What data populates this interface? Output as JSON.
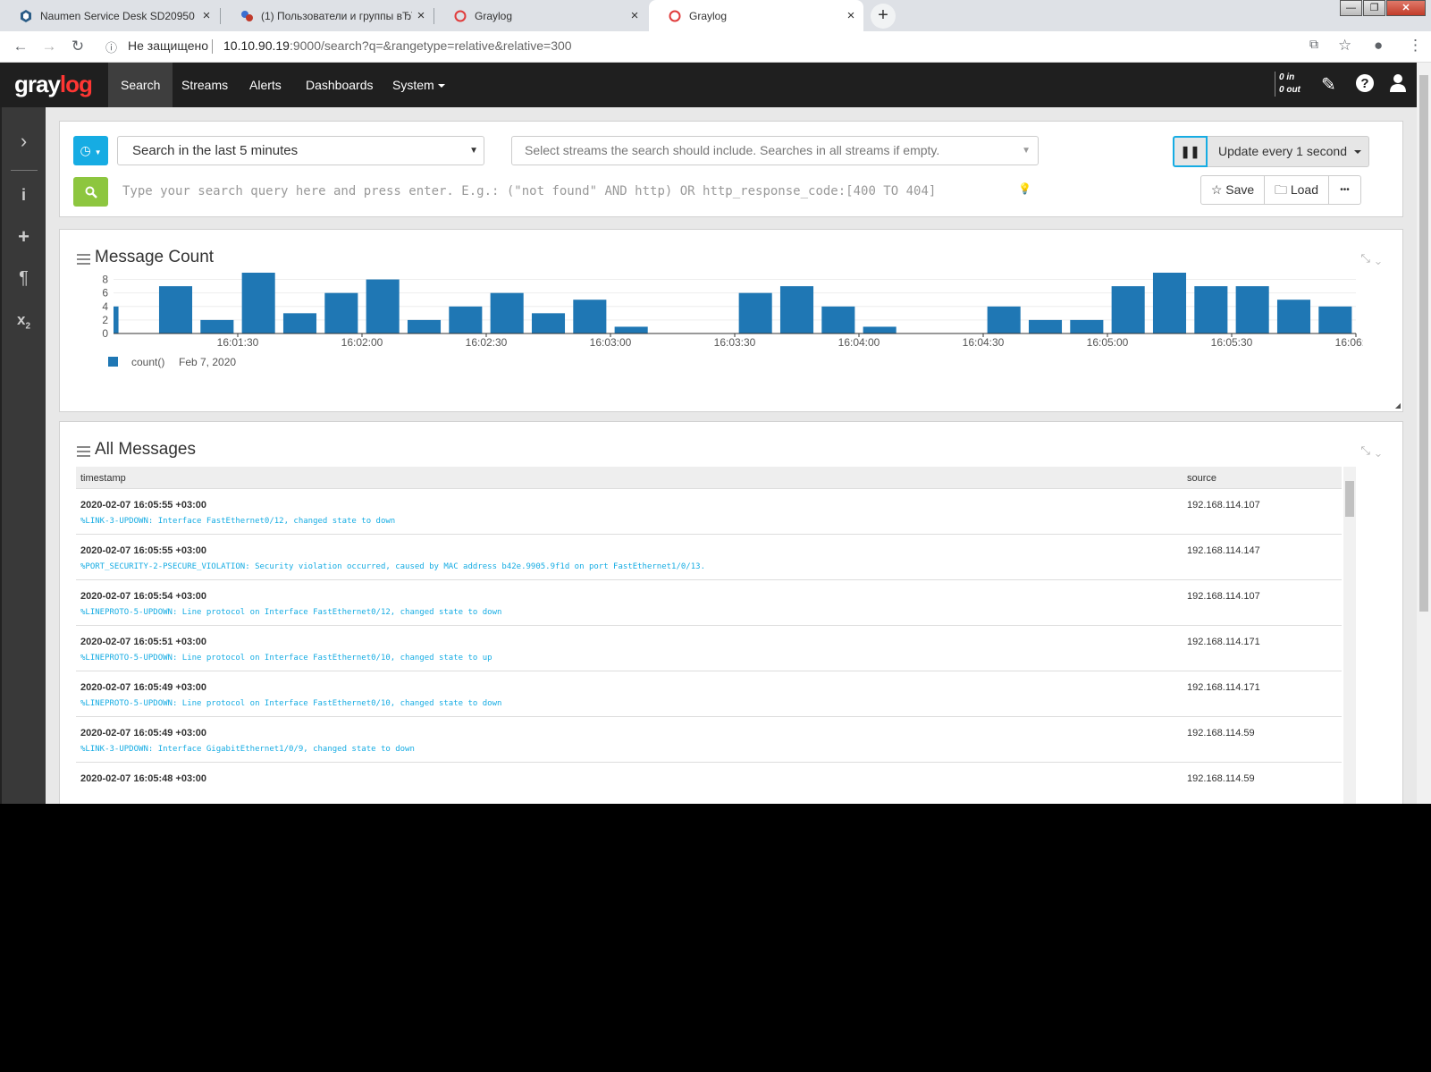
{
  "browser": {
    "tabs": [
      {
        "title": "Naumen Service Desk SD20950",
        "close": "×"
      },
      {
        "title": "(1) Пользователи и группы вЂ˘",
        "close": "×"
      },
      {
        "title": "Graylog",
        "close": "×"
      },
      {
        "title": "Graylog",
        "close": "×"
      }
    ],
    "new_tab": "+",
    "window_controls": {
      "minimize": "—",
      "maximize": "❐",
      "close": "✕"
    },
    "security_label": "Не защищено",
    "url_host": "10.10.90.19",
    "url_rest": ":9000/search?q=&rangetype=relative&relative=300"
  },
  "nav": {
    "logo_gray": "gray",
    "logo_log": "log",
    "items": [
      "Search",
      "Streams",
      "Alerts",
      "Dashboards",
      "System"
    ],
    "throughput_in": "0 in",
    "throughput_out": "0 out"
  },
  "search": {
    "range_value": "Search in the last 5 minutes",
    "streams_placeholder": "Select streams the search should include. Searches in all streams if empty.",
    "update_label": "Update every 1 second",
    "query_placeholder": "Type your search query here and press enter. E.g.: (\"not found\" AND http) OR http_response_code:[400 TO 404]",
    "save_label": "Save",
    "load_label": "Load",
    "more_label": "•••"
  },
  "message_count": {
    "title": "Message Count"
  },
  "chart_data": {
    "type": "bar",
    "title": "Message Count",
    "y_ticks": [
      "0",
      "2",
      "4",
      "6",
      "8"
    ],
    "ylim": [
      0,
      9
    ],
    "x_tick_labels": [
      "16:01:30",
      "16:02:00",
      "16:02:30",
      "16:03:00",
      "16:03:30",
      "16:04:00",
      "16:04:30",
      "16:05:00",
      "16:05:30",
      "16:06:00"
    ],
    "x_start": "16:01:00",
    "x_end": "16:06:00",
    "bin_seconds": 10,
    "series": [
      {
        "name": "count()",
        "color": "#1f77b4",
        "bins": [
          {
            "t": "16:01:00",
            "v": 4
          },
          {
            "t": "16:01:10",
            "v": 7
          },
          {
            "t": "16:01:20",
            "v": 2
          },
          {
            "t": "16:01:30",
            "v": 9
          },
          {
            "t": "16:01:40",
            "v": 3
          },
          {
            "t": "16:01:50",
            "v": 6
          },
          {
            "t": "16:02:00",
            "v": 8
          },
          {
            "t": "16:02:10",
            "v": 2
          },
          {
            "t": "16:02:20",
            "v": 4
          },
          {
            "t": "16:02:30",
            "v": 6
          },
          {
            "t": "16:02:40",
            "v": 3
          },
          {
            "t": "16:02:50",
            "v": 5
          },
          {
            "t": "16:03:00",
            "v": 1
          },
          {
            "t": "16:03:10",
            "v": 0
          },
          {
            "t": "16:03:20",
            "v": 0
          },
          {
            "t": "16:03:30",
            "v": 6
          },
          {
            "t": "16:03:40",
            "v": 7
          },
          {
            "t": "16:03:50",
            "v": 4
          },
          {
            "t": "16:04:00",
            "v": 1
          },
          {
            "t": "16:04:10",
            "v": 0
          },
          {
            "t": "16:04:20",
            "v": 0
          },
          {
            "t": "16:04:30",
            "v": 4
          },
          {
            "t": "16:04:40",
            "v": 2
          },
          {
            "t": "16:04:50",
            "v": 2
          },
          {
            "t": "16:05:00",
            "v": 7
          },
          {
            "t": "16:05:10",
            "v": 9
          },
          {
            "t": "16:05:20",
            "v": 7
          },
          {
            "t": "16:05:30",
            "v": 7
          },
          {
            "t": "16:05:40",
            "v": 5
          },
          {
            "t": "16:05:50",
            "v": 4
          }
        ]
      }
    ],
    "legend": {
      "label": "count()",
      "date": "Feb 7, 2020",
      "placement": "bottom-left"
    }
  },
  "messages": {
    "title": "All Messages",
    "columns": [
      "timestamp",
      "source"
    ],
    "rows": [
      {
        "timestamp": "2020-02-07 16:05:55 +03:00",
        "message": "%LINK-3-UPDOWN: Interface FastEthernet0/12, changed state to down",
        "source": "192.168.114.107"
      },
      {
        "timestamp": "2020-02-07 16:05:55 +03:00",
        "message": "%PORT_SECURITY-2-PSECURE_VIOLATION: Security violation occurred, caused by MAC address b42e.9905.9f1d on port FastEthernet1/0/13.",
        "source": "192.168.114.147"
      },
      {
        "timestamp": "2020-02-07 16:05:54 +03:00",
        "message": "%LINEPROTO-5-UPDOWN: Line protocol on Interface FastEthernet0/12, changed state to down",
        "source": "192.168.114.107"
      },
      {
        "timestamp": "2020-02-07 16:05:51 +03:00",
        "message": "%LINEPROTO-5-UPDOWN: Line protocol on Interface FastEthernet0/10, changed state to up",
        "source": "192.168.114.171"
      },
      {
        "timestamp": "2020-02-07 16:05:49 +03:00",
        "message": "%LINEPROTO-5-UPDOWN: Line protocol on Interface FastEthernet0/10, changed state to down",
        "source": "192.168.114.171"
      },
      {
        "timestamp": "2020-02-07 16:05:49 +03:00",
        "message": "%LINK-3-UPDOWN: Interface GigabitEthernet1/0/9, changed state to down",
        "source": "192.168.114.59"
      },
      {
        "timestamp": "2020-02-07 16:05:48 +03:00",
        "message": "",
        "source": "192.168.114.59"
      }
    ]
  },
  "colors": {
    "accent": "#16ace3",
    "search_green": "#8dc63f",
    "logo_red": "#ff3633",
    "header_bg": "#1f1f1f",
    "sidebar_bg": "#393939"
  }
}
